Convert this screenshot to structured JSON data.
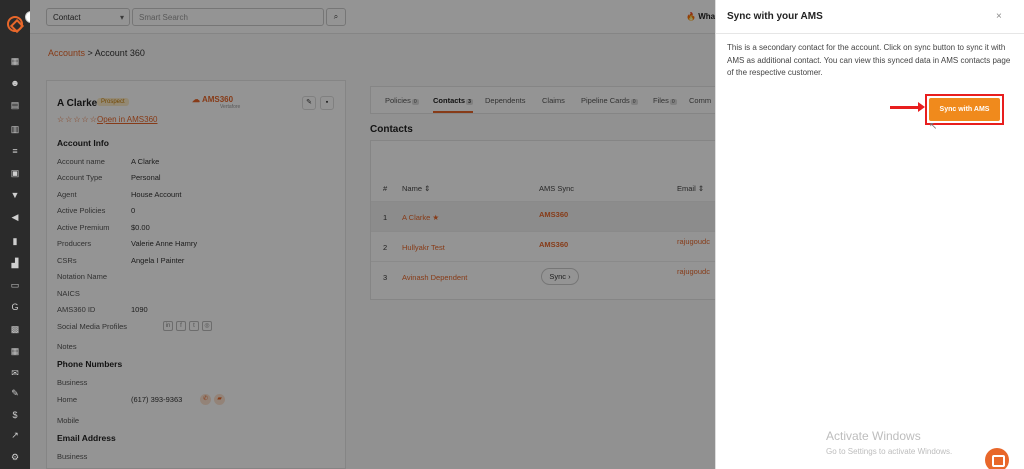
{
  "topbar": {
    "search_type": "Contact",
    "search_placeholder": "Smart Search",
    "whats_new": "Wha"
  },
  "breadcrumb": {
    "parent": "Accounts",
    "separator": " > ",
    "current": "Account 360"
  },
  "account": {
    "name": "A Clarke",
    "badge": "Prospect",
    "ams_logo": "AMS360",
    "ams_logo_sub": "Vertafore",
    "stars": "☆☆☆☆☆",
    "open_link": "Open in AMS360",
    "info_title": "Account Info",
    "fields": [
      {
        "label": "Account name",
        "value": "A Clarke"
      },
      {
        "label": "Account Type",
        "value": "Personal"
      },
      {
        "label": "Agent",
        "value": "House Account"
      },
      {
        "label": "Active Policies",
        "value": "0"
      },
      {
        "label": "Active Premium",
        "value": "$0.00"
      },
      {
        "label": "Producers",
        "value": "Valerie Anne Hamry"
      },
      {
        "label": "CSRs",
        "value": "Angela I Painter"
      },
      {
        "label": "Notation Name",
        "value": ""
      },
      {
        "label": "NAICS",
        "value": ""
      },
      {
        "label": "AMS360 ID",
        "value": "1090"
      },
      {
        "label": "Social Media Profiles",
        "value": ""
      },
      {
        "label": "Notes",
        "value": ""
      }
    ],
    "phone_title": "Phone Numbers",
    "phones": [
      {
        "label": "Business",
        "value": ""
      },
      {
        "label": "Home",
        "value": "(617) 393-9363"
      },
      {
        "label": "Mobile",
        "value": ""
      }
    ],
    "email_title": "Email Address",
    "emails": [
      {
        "label": "Business",
        "value": ""
      }
    ]
  },
  "tabs": [
    {
      "label": "Policies",
      "count": "0"
    },
    {
      "label": "Contacts",
      "count": "3"
    },
    {
      "label": "Dependents",
      "count": ""
    },
    {
      "label": "Claims",
      "count": ""
    },
    {
      "label": "Pipeline Cards",
      "count": "0"
    },
    {
      "label": "Files",
      "count": "0"
    },
    {
      "label": "Comm",
      "count": ""
    }
  ],
  "contacts": {
    "title": "Contacts",
    "headers": {
      "num": "#",
      "name": "Name ⇕",
      "ams": "AMS Sync",
      "email": "Email ⇕"
    },
    "rows": [
      {
        "num": "1",
        "name": "A Clarke ★",
        "ams": "AMS360",
        "email": ""
      },
      {
        "num": "2",
        "name": "Hullyakr Test",
        "ams": "AMS360",
        "email": "rajugoudc"
      },
      {
        "num": "3",
        "name": "Avinash Dependent",
        "ams": "Sync ›",
        "email": "rajugoudc"
      }
    ]
  },
  "drawer": {
    "title": "Sync with your AMS",
    "close": "×",
    "description": "This is a secondary contact for the account. Click on sync button to sync it with AMS as additional contact. You can view this synced data in AMS contacts page of the respective customer.",
    "sync_button": "Sync with AMS"
  },
  "watermark": {
    "line1": "Activate Windows",
    "line2": "Go to Settings to activate Windows."
  },
  "colors": {
    "accent": "#e8672a",
    "cta": "#f08a1c",
    "highlight": "#e81e1e",
    "rail": "#2b2b2b"
  }
}
